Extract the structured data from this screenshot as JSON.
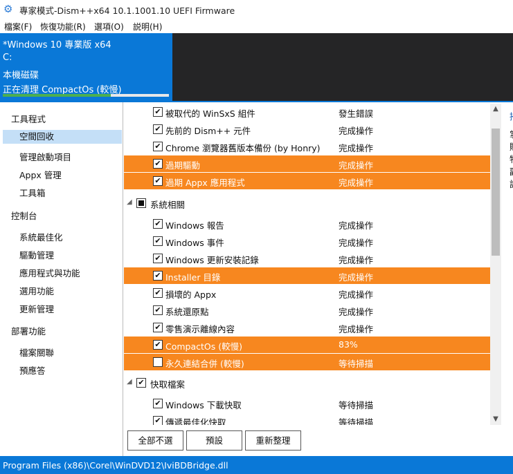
{
  "window": {
    "title": "專家模式-Dism++x64 10.1.1001.10 UEFI Firmware",
    "icon": "gear-icon"
  },
  "menu": [
    "檔案(F)",
    "恢復功能(R)",
    "選項(O)",
    "説明(H)"
  ],
  "header": {
    "os": "*Windows 10 專業版 x64",
    "drive": "C:",
    "disk": "本機磁碟",
    "task": "正在清理 CompactOs (較慢)",
    "progress_percent": 65,
    "progress_color": "#4caf50",
    "accent_color": "#0a78d7"
  },
  "sidebar": [
    {
      "label": "工具程式",
      "type": "section"
    },
    {
      "label": "空間回收",
      "type": "item",
      "selected": true
    },
    {
      "label": "管理啟動項目",
      "type": "item"
    },
    {
      "label": "Appx 管理",
      "type": "item"
    },
    {
      "label": "工具箱",
      "type": "item"
    },
    {
      "label": "控制台",
      "type": "section"
    },
    {
      "label": "系統最佳化",
      "type": "item"
    },
    {
      "label": "驅動管理",
      "type": "item"
    },
    {
      "label": "應用程式與功能",
      "type": "item"
    },
    {
      "label": "選用功能",
      "type": "item"
    },
    {
      "label": "更新管理",
      "type": "item"
    },
    {
      "label": "部署功能",
      "type": "section"
    },
    {
      "label": "檔案關聯",
      "type": "item"
    },
    {
      "label": "預應答",
      "type": "item"
    }
  ],
  "rows": [
    {
      "type": "item",
      "name": "被取代的 WinSxS 組件",
      "status": "發生錯誤",
      "checked": true
    },
    {
      "type": "item",
      "name": "先前的 Dism++ 元件",
      "status": "完成操作",
      "checked": true
    },
    {
      "type": "item",
      "name": "Chrome 瀏覽器舊版本備份 (by Honry)",
      "status": "完成操作",
      "checked": true
    },
    {
      "type": "item",
      "name": "過期驅動",
      "status": "完成操作",
      "checked": true,
      "highlight": true
    },
    {
      "type": "item",
      "name": "過期 Appx 應用程式",
      "status": "完成操作",
      "checked": true,
      "highlight": true
    },
    {
      "type": "group",
      "name": "系統相關",
      "checked": "partial"
    },
    {
      "type": "item",
      "name": "Windows 報告",
      "status": "完成操作",
      "checked": true
    },
    {
      "type": "item",
      "name": "Windows 事件",
      "status": "完成操作",
      "checked": true
    },
    {
      "type": "item",
      "name": "Windows 更新安裝記錄",
      "status": "完成操作",
      "checked": true
    },
    {
      "type": "item",
      "name": "Installer 目錄",
      "status": "完成操作",
      "checked": true,
      "highlight": true
    },
    {
      "type": "item",
      "name": "損壞的 Appx",
      "status": "完成操作",
      "checked": true
    },
    {
      "type": "item",
      "name": "系統還原點",
      "status": "完成操作",
      "checked": true
    },
    {
      "type": "item",
      "name": "零售演示離線內容",
      "status": "完成操作",
      "checked": true
    },
    {
      "type": "item",
      "name": "CompactOs (較慢)",
      "status": "83%",
      "checked": true,
      "highlight": true
    },
    {
      "type": "item",
      "name": "永久連結合併 (較慢)",
      "status": "等待掃描",
      "checked": false,
      "highlight": true
    },
    {
      "type": "group",
      "name": "快取檔案",
      "checked": true
    },
    {
      "type": "item",
      "name": "Windows 下載快取",
      "status": "等待掃描",
      "checked": true
    },
    {
      "type": "item",
      "name": "傳遞最佳化快取",
      "status": "等待掃描",
      "checked": true
    }
  ],
  "highlight_color": "#f7871f",
  "right_panel": [
    "掃",
    "掌",
    "賦",
    "物",
    "副",
    "詳"
  ],
  "buttons": {
    "deselect_all": "全部不選",
    "default": "預設",
    "reorganize": "重新整理"
  },
  "status_bar": "Program Files (x86)\\Corel\\WinDVD12\\IviBDBridge.dll"
}
